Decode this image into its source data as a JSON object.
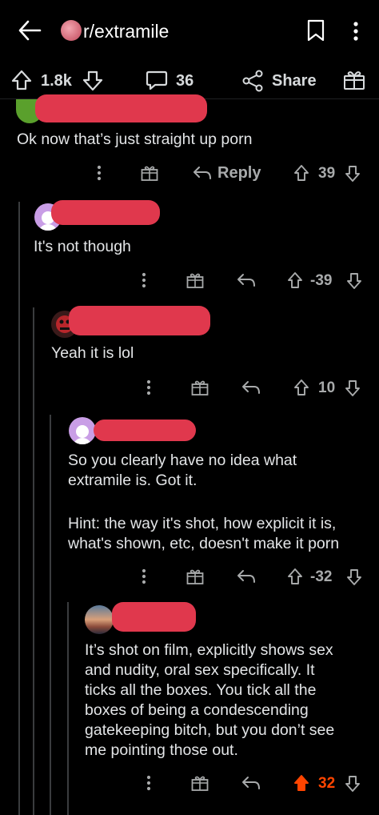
{
  "header": {
    "title": "r/extramile"
  },
  "post_bar": {
    "upvotes": "1.8k",
    "comments": "36",
    "share_label": "Share"
  },
  "comments": [
    {
      "text": "Ok now that’s just straight up porn",
      "reply_label": "Reply",
      "score": "39"
    },
    {
      "text": "It's not though",
      "score": "-39"
    },
    {
      "text": "Yeah it is lol",
      "score": "10"
    },
    {
      "text_p1": "So you clearly have no idea what extramile is. Got it.",
      "text_p2": "Hint: the way it's shot, how explicit it is, what's shown, etc, doesn't make it porn",
      "score": "-32"
    },
    {
      "text": "It’s shot on film, explicitly shows sex and nudity, oral sex specifically. It ticks all the boxes. You tick all the boxes of being a condescending gatekeeping bitch, but you don’t see me pointing those out.",
      "score": "32"
    }
  ],
  "colors": {
    "background": "#000000",
    "redaction": "#e0384d",
    "upvote_active": "#ff4500"
  },
  "icons": [
    "back-arrow-icon",
    "subreddit-avatar-icon",
    "bookmark-icon",
    "kebab-menu-icon",
    "upvote-icon",
    "downvote-icon",
    "comment-bubble-icon",
    "share-icon",
    "award-icon",
    "reply-arrow-icon"
  ]
}
